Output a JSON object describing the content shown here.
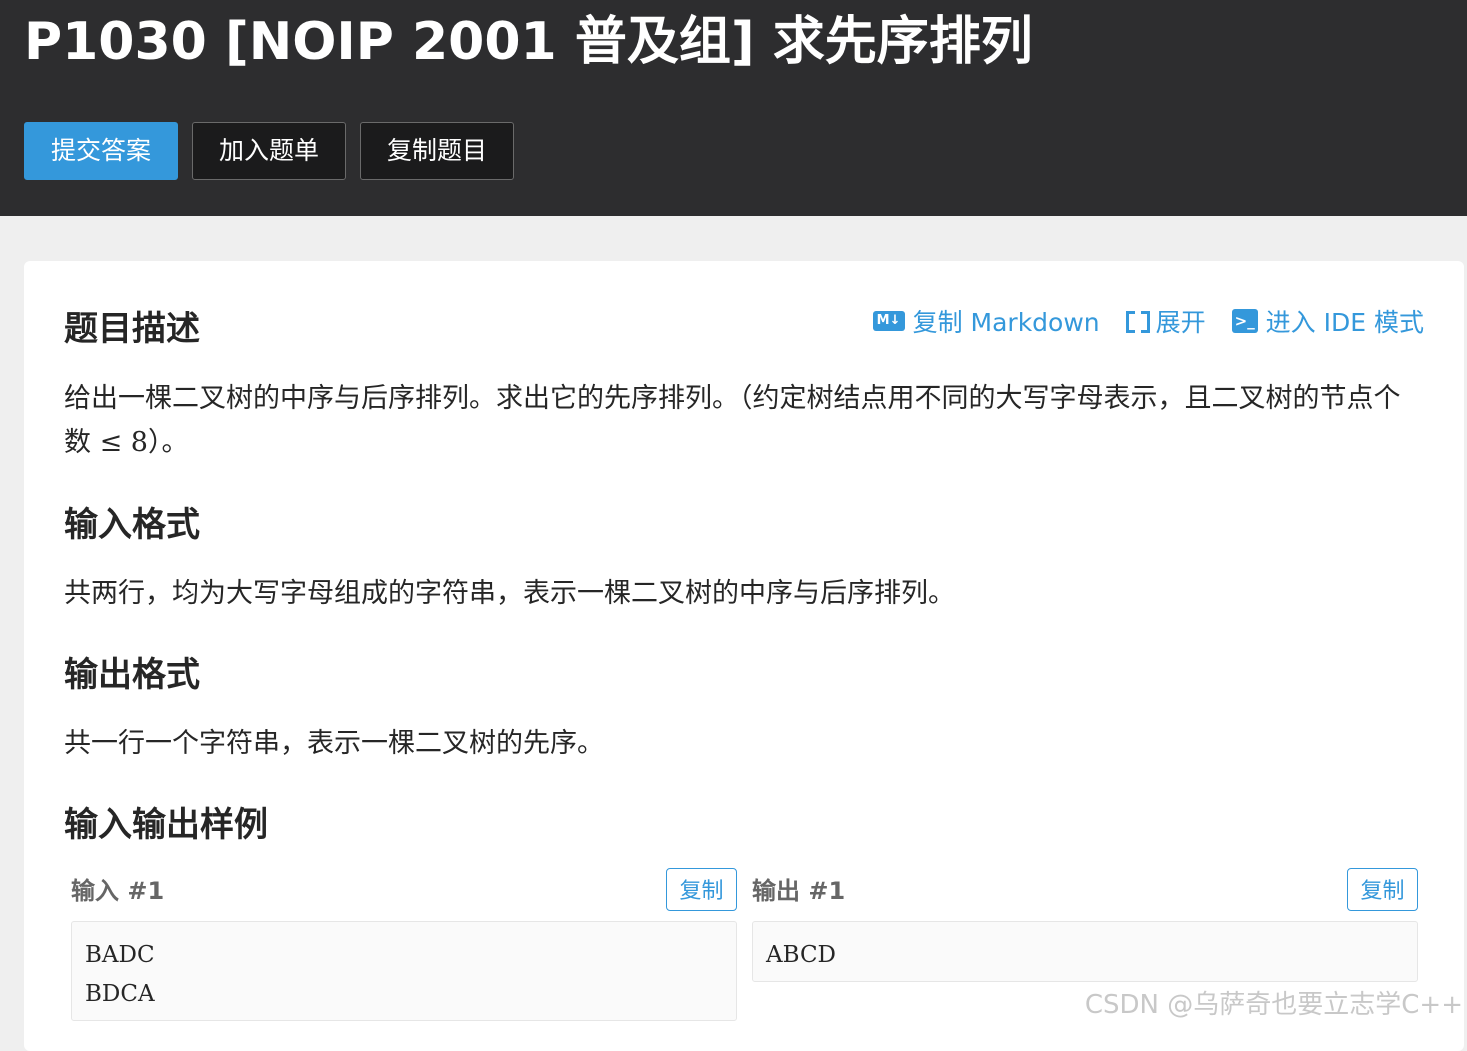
{
  "header": {
    "title": "P1030 [NOIP 2001 普及组] 求先序排列",
    "buttons": {
      "submit": "提交答案",
      "add_to_list": "加入题单",
      "copy_problem": "复制题目"
    }
  },
  "toolbar": {
    "md_badge": "M↓",
    "copy_markdown": "复制 Markdown",
    "expand": "展开",
    "ide_badge": ">_",
    "ide_mode": "进入 IDE 模式"
  },
  "description": {
    "title": "题目描述",
    "text_before": "给出一棵二叉树的中序与后序排列。求出它的先序排列。（约定树结点用不同的大写字母表示，且二叉树的节点个数 ",
    "math": "≤ 8",
    "text_after": "）。"
  },
  "input_format": {
    "title": "输入格式",
    "text": "共两行，均为大写字母组成的字符串，表示一棵二叉树的中序与后序排列。"
  },
  "output_format": {
    "title": "输出格式",
    "text": "共一行一个字符串，表示一棵二叉树的先序。"
  },
  "samples": {
    "title": "输入输出样例",
    "input_label": "输入 #1",
    "output_label": "输出 #1",
    "copy_label": "复制",
    "input_text": "BADC\nBDCA",
    "output_text": "ABCD"
  },
  "watermark": "CSDN @乌萨奇也要立志学C++"
}
